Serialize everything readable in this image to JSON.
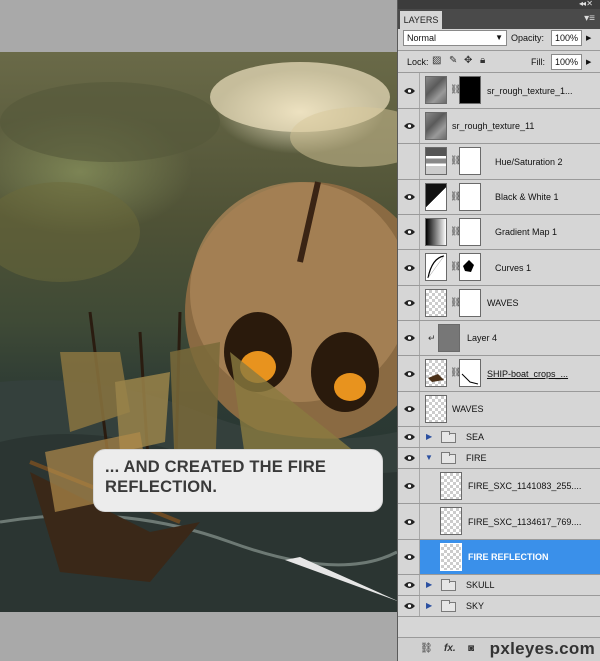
{
  "panel": {
    "tab_label": "LAYERS",
    "blend_mode": "Normal",
    "opacity_label": "Opacity:",
    "opacity_value": "100%",
    "lock_label": "Lock:",
    "fill_label": "Fill:",
    "fill_value": "100%",
    "collapse_icon": "double-chevron-right-icon",
    "menu_icon": "panel-menu-icon"
  },
  "callout": {
    "text": "... AND CREATED THE FIRE\nREFLECTION."
  },
  "layers": [
    {
      "name": "sr_rough_texture_1...",
      "visible": true,
      "type": "masked-texture"
    },
    {
      "name": "sr_rough_texture_11",
      "visible": true,
      "type": "texture"
    },
    {
      "name": "Hue/Saturation 2",
      "visible": false,
      "type": "adjustment-hs"
    },
    {
      "name": "Black & White 1",
      "visible": true,
      "type": "adjustment-bw"
    },
    {
      "name": "Gradient Map 1",
      "visible": true,
      "type": "adjustment-gradient"
    },
    {
      "name": "Curves 1",
      "visible": true,
      "type": "adjustment-curves"
    },
    {
      "name": "WAVES",
      "visible": true,
      "type": "masked"
    },
    {
      "name": "Layer 4",
      "visible": true,
      "type": "clipped"
    },
    {
      "name": "SHIP-boat_crops_...",
      "visible": true,
      "type": "masked-ship"
    },
    {
      "name": "WAVES",
      "visible": true,
      "type": "plain"
    },
    {
      "name": "SEA",
      "visible": true,
      "type": "group-collapsed"
    },
    {
      "name": "FIRE",
      "visible": true,
      "type": "group-open"
    },
    {
      "name": "FIRE_SXC_1141083_255....",
      "visible": true,
      "type": "nested"
    },
    {
      "name": "FIRE_SXC_1134617_769....",
      "visible": true,
      "type": "nested"
    },
    {
      "name": "FIRE REFLECTION",
      "visible": true,
      "type": "nested-selected"
    },
    {
      "name": "SKULL",
      "visible": true,
      "type": "group-collapsed"
    },
    {
      "name": "SKY",
      "visible": true,
      "type": "group-collapsed"
    }
  ],
  "bottom_icons": [
    "link-layers-icon",
    "fx-icon",
    "add-mask-icon",
    "adjustment-icon",
    "new-group-icon",
    "new-layer-icon",
    "trash-icon"
  ],
  "watermark": "pxleyes.com"
}
